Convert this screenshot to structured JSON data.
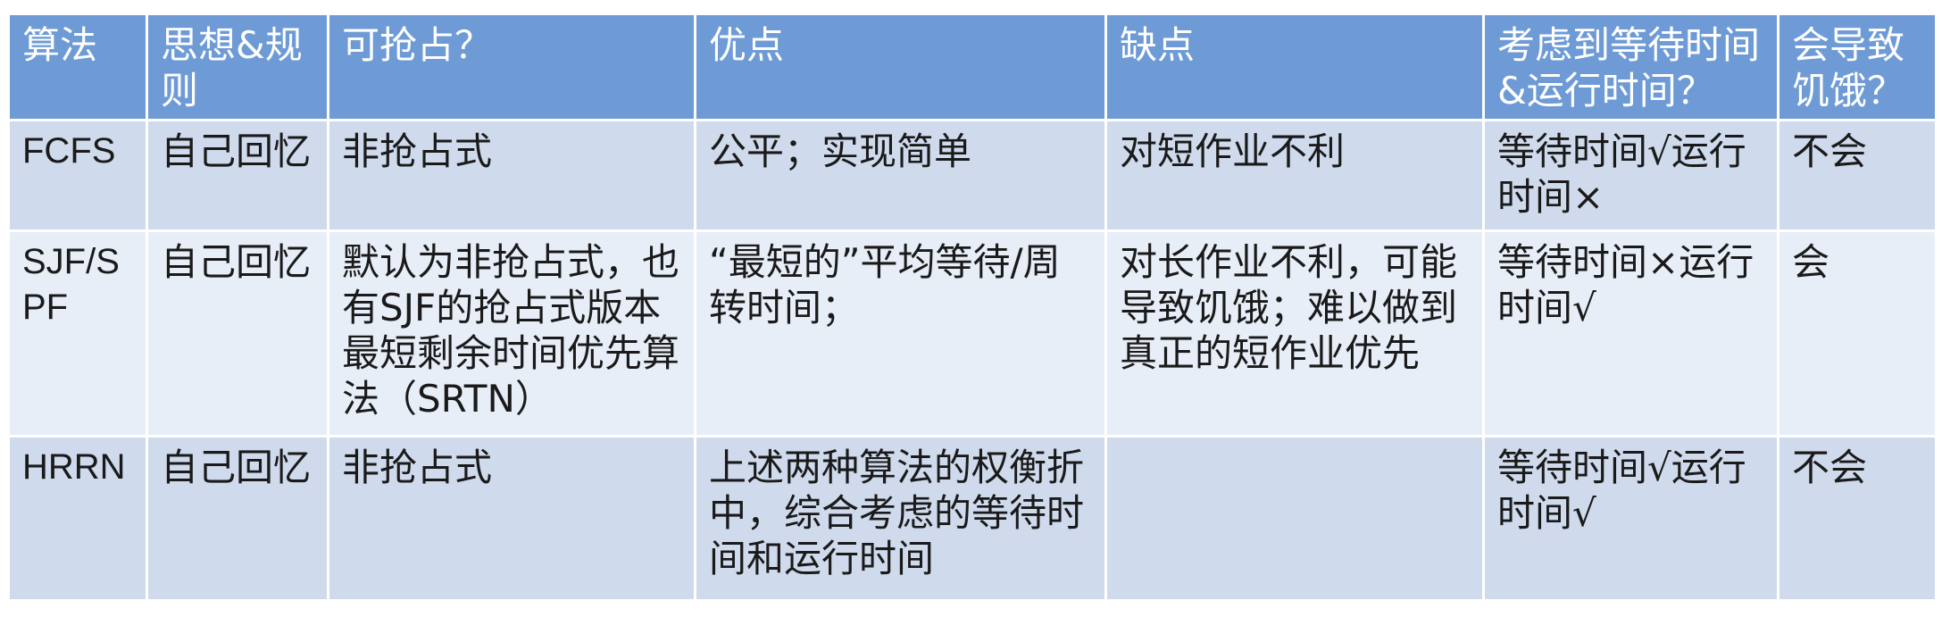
{
  "table": {
    "headers": [
      "算法",
      "思想&规则",
      "可抢占？",
      "优点",
      "缺点",
      "考虑到等待时间&运行时间？",
      "会导致饥饿？"
    ],
    "rows": [
      {
        "algorithm": "FCFS",
        "idea": "自己回忆",
        "preemptive": "非抢占式",
        "advantages": "公平；实现简单",
        "disadvantages": "对短作业不利",
        "considers": "等待时间√运行时间×",
        "starvation": "不会"
      },
      {
        "algorithm": "SJF/SPF",
        "idea": "自己回忆",
        "preemptive": "默认为非抢占式，也有SJF的抢占式版本最短剩余时间优先算法（SRTN）",
        "advantages": "“最短的”平均等待/周转时间；",
        "disadvantages": "对长作业不利，可能导致饥饿；难以做到真正的短作业优先",
        "considers": "等待时间×运行时间√",
        "starvation": "会"
      },
      {
        "algorithm": "HRRN",
        "idea": "自己回忆",
        "preemptive": "非抢占式",
        "advantages": "上述两种算法的权衡折中，综合考虑的等待时间和运行时间",
        "disadvantages": "",
        "considers": "等待时间√运行时间√",
        "starvation": "不会"
      }
    ]
  },
  "colors": {
    "header_bg": "#6e9bd6",
    "row_dark": "#cfdaec",
    "row_light": "#e8eef7"
  }
}
